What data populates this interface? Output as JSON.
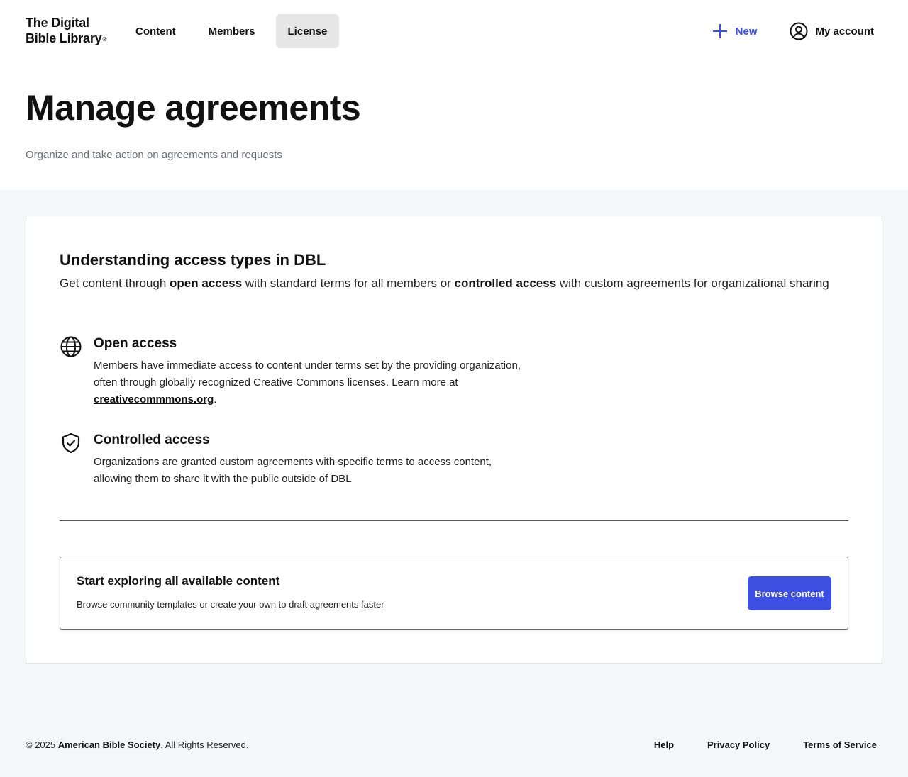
{
  "header": {
    "logo_line1": "The Digital",
    "logo_line2": "Bible Library",
    "logo_mark": "®",
    "nav": [
      {
        "label": "Content"
      },
      {
        "label": "Members"
      },
      {
        "label": "License",
        "active": true
      }
    ],
    "new_label": "New",
    "account_label": "My account",
    "accent_color": "#3c4fe0"
  },
  "page": {
    "title": "Manage agreements",
    "subtitle": "Organize and take action on agreements and requests"
  },
  "access_card": {
    "heading": "Understanding access types in DBL",
    "intro": {
      "part1": "Get content through ",
      "bold1": "open access",
      "part2": " with standard terms for all members or ",
      "bold2": "controlled access",
      "part3": " with custom agreements for organizational sharing"
    },
    "open_access": {
      "icon": "globe-icon",
      "title": "Open access",
      "text": "Members have immediate access to content under terms set by the providing organization, often through globally recognized Creative Commons licenses. Learn more at ",
      "link": "creativecommmons.org",
      "text_end": "."
    },
    "controlled_access": {
      "icon": "shield-check-icon",
      "title": "Controlled access",
      "text": "Organizations are granted custom agreements with specific terms to access content, allowing them to share it with the public outside of DBL"
    },
    "explore": {
      "title": "Start exploring all available content",
      "text": "Browse community templates or create your own to draft agreements faster",
      "button": "Browse content"
    }
  },
  "footer": {
    "copyright_prefix": "© 2025 ",
    "org_link": "American Bible Society",
    "copyright_suffix": ". All Rights Reserved.",
    "links": [
      "Help",
      "Privacy Policy",
      "Terms of Service"
    ]
  }
}
